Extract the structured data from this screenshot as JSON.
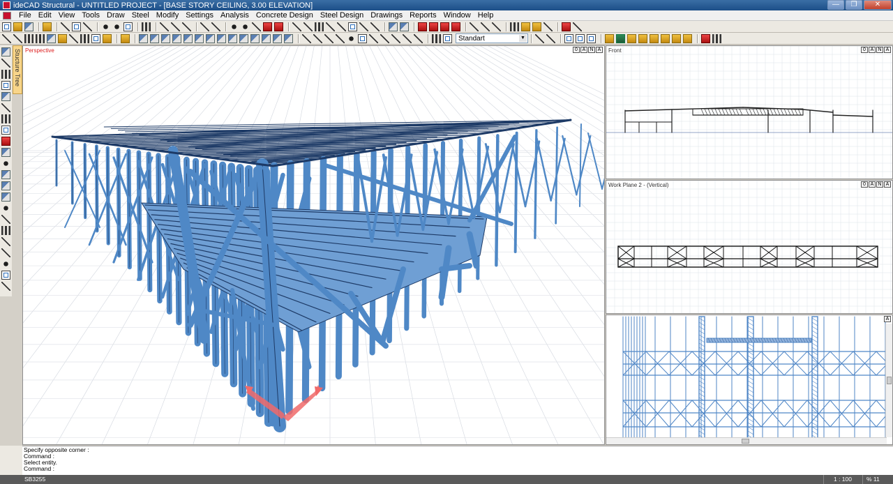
{
  "window": {
    "title": "ideCAD Structural - UNTITLED PROJECT - [BASE STORY CEILING,  3.00 ELEVATION]",
    "controls": [
      "—",
      "❐",
      "✕"
    ]
  },
  "menu": [
    "File",
    "Edit",
    "View",
    "Tools",
    "Draw",
    "Steel",
    "Modify",
    "Settings",
    "Analysis",
    "Concrete Design",
    "Steel Design",
    "Drawings",
    "Reports",
    "Window",
    "Help"
  ],
  "toolbar": {
    "style_combo_value": "Standart"
  },
  "structure_tree_tab": "Stucture Tree",
  "viewports": {
    "perspective": {
      "label": "Perspective",
      "controls": [
        "0",
        "A",
        "N",
        "A"
      ]
    },
    "front": {
      "label": "Front",
      "controls": [
        "0",
        "A",
        "N",
        "A"
      ]
    },
    "work_plane": {
      "label": "Work Plane 2 - (Vertical)",
      "controls": [
        "0",
        "A",
        "N",
        "A"
      ]
    },
    "plan": {
      "controls": [
        "A"
      ]
    }
  },
  "command_history": [
    "Specify opposite corner :",
    "Command :",
    "Select entity.",
    "Command :"
  ],
  "status": {
    "left": "SB3255",
    "scale": "1 : 100",
    "zoom": "% 11"
  },
  "colors": {
    "steel": "#4f88c6",
    "steel_dark": "#1d3a66",
    "grid": "#c8ccd4",
    "axis_marker": "#f06a6a"
  }
}
